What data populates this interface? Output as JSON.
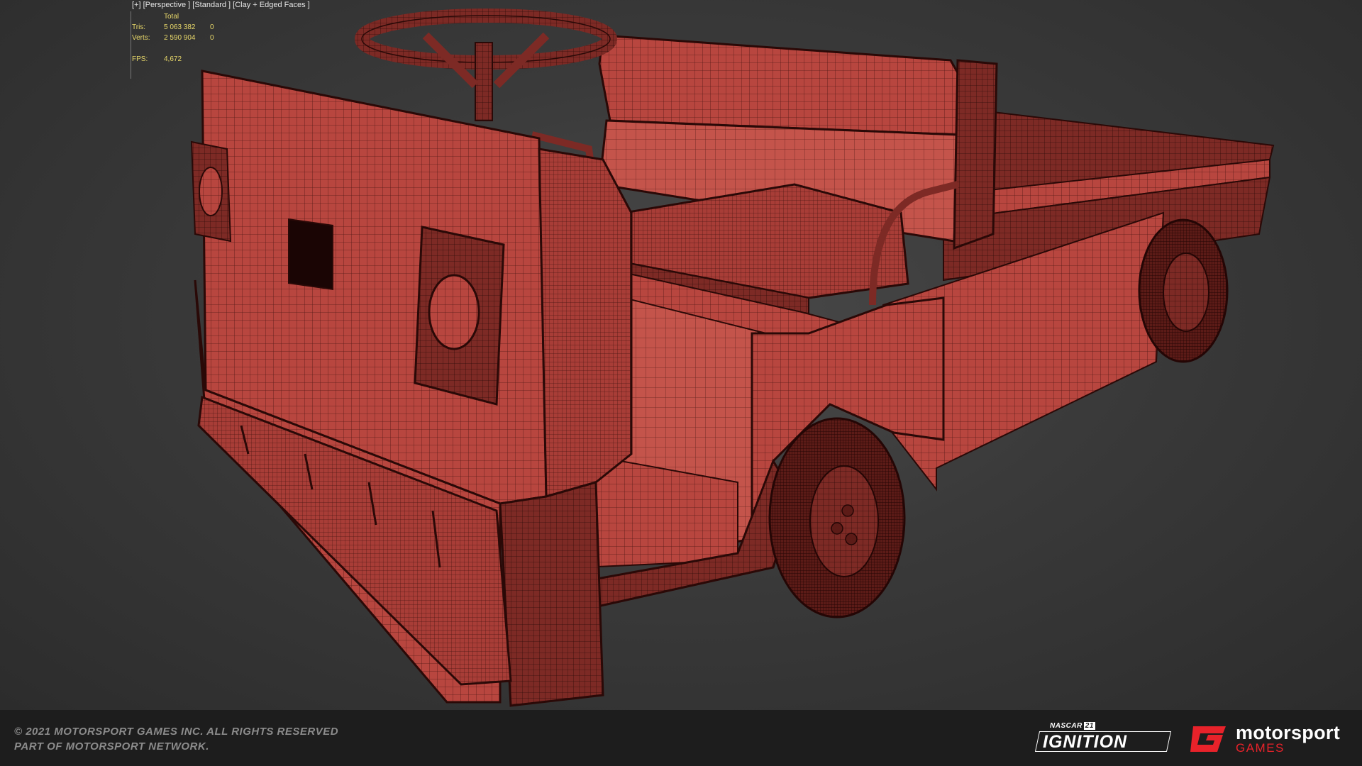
{
  "viewport": {
    "label": "[+] [Perspective ] [Standard ] [Clay + Edged Faces ]",
    "stats": {
      "header": "Total",
      "rows": [
        {
          "label": "Tris:",
          "value": "5 063 382",
          "selected": "0"
        },
        {
          "label": "Verts:",
          "value": "2 590 904",
          "selected": "0"
        }
      ],
      "fps_label": "FPS:",
      "fps_value": "4,672"
    },
    "model": {
      "subject": "utility-cart-wireframe",
      "clay_color": "#b8463f",
      "wire_color": "#3a0f0c"
    }
  },
  "footer": {
    "copyright_line1": "© 2021 MOTORSPORT GAMES INC. ALL RIGHTS RESERVED",
    "copyright_line2": "PART OF MOTORSPORT NETWORK.",
    "nascar_label": "NASCAR",
    "nascar_number": "21",
    "ignition_label": "IGNITION",
    "brand_name": "motorsport",
    "brand_sub": "GAMES",
    "brand_color": "#e8222a"
  }
}
